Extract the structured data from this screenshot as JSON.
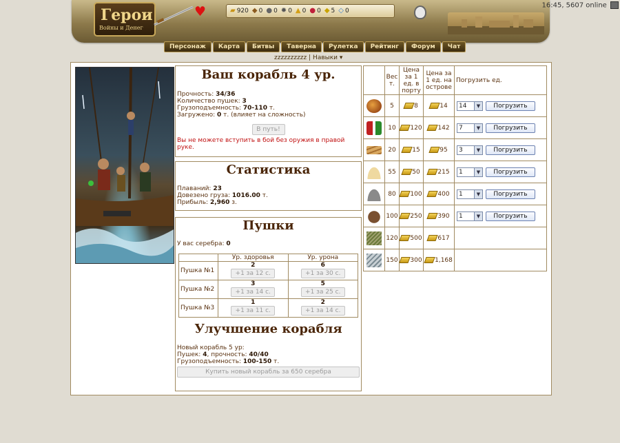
{
  "header": {
    "logo_title": "Герои",
    "logo_subtitle": "Войны и Денег",
    "resources": [
      {
        "icon": "gold-icon",
        "value": "920"
      },
      {
        "icon": "wood-icon",
        "value": "0"
      },
      {
        "icon": "ore-icon",
        "value": "0"
      },
      {
        "icon": "gear-resource-icon",
        "value": "0"
      },
      {
        "icon": "crystal-icon",
        "value": "0"
      },
      {
        "icon": "gem-icon",
        "value": "0"
      },
      {
        "icon": "sulfur-icon",
        "value": "5"
      },
      {
        "icon": "diamond-icon",
        "value": "0"
      }
    ],
    "clock": "16:45, 5607 online"
  },
  "nav": [
    "Персонаж",
    "Карта",
    "Битвы",
    "Таверна",
    "Рулетка",
    "Рейтинг",
    "Форум",
    "Чат"
  ],
  "subnav": {
    "user": "zzzzzzzzzz",
    "sep": "|",
    "skills": "Навыки ▾"
  },
  "ship": {
    "title": "Ваш корабль 4 ур.",
    "durability_label": "Прочность: ",
    "durability": "34/36",
    "cannons_label": "Количество пушек: ",
    "cannons": "3",
    "capacity_label": "Грузоподъемность: ",
    "capacity": "70-110",
    "capacity_unit": " т.",
    "loaded_label": "Загружено: ",
    "loaded": "0",
    "loaded_note": " т. (влияет на сложность)",
    "go_button": "В путь!",
    "warning": "Вы не можете вступить в бой без оружия в правой руке."
  },
  "stats": {
    "title": "Статистика",
    "voyages_label": "Плаваний: ",
    "voyages": "23",
    "delivered_label": "Довезено груза: ",
    "delivered": "1016.00",
    "delivered_unit": " т.",
    "profit_label": "Прибыль: ",
    "profit": "2,960",
    "profit_unit": " з."
  },
  "cannons": {
    "title": "Пушки",
    "silver_label": "У вас серебра: ",
    "silver": "0",
    "col_health": "Ур. здоровья",
    "col_damage": "Ур. урона",
    "rows": [
      {
        "name": "Пушка №1",
        "health": "2",
        "health_btn": "+1 за 12 с.",
        "damage": "6",
        "damage_btn": "+1 за 30 с."
      },
      {
        "name": "Пушка №2",
        "health": "3",
        "health_btn": "+1 за 14 с.",
        "damage": "5",
        "damage_btn": "+1 за 25 с."
      },
      {
        "name": "Пушка №3",
        "health": "1",
        "health_btn": "+1 за 11 с.",
        "damage": "2",
        "damage_btn": "+1 за 14 с."
      }
    ]
  },
  "upgrade": {
    "title": "Улучшение корабля",
    "line1": "Новый корабль 5 ур:",
    "cannons_label": "Пушек: ",
    "cannons": "4",
    "durability_label": ", прочность: ",
    "durability": "40/40",
    "capacity_label": "Грузоподъемность: ",
    "capacity": "100-150",
    "capacity_unit": " т.",
    "buy_button": "Купить новый корабль за 650 серебра"
  },
  "cargo": {
    "headers": {
      "weight": "Вес т.",
      "port_price": "Цена за 1 ед. в порту",
      "island_price": "Цена за 1 ед. на острове",
      "load": "Погрузить ед."
    },
    "load_button": "Погрузить",
    "rows": [
      {
        "icon": "fruit-sack-icon",
        "weight": "5",
        "port": "8",
        "island": "14",
        "qty": "14"
      },
      {
        "icon": "potion-bottles-icon",
        "weight": "10",
        "port": "120",
        "island": "142",
        "qty": "7"
      },
      {
        "icon": "wood-planks-icon",
        "weight": "20",
        "port": "15",
        "island": "95",
        "qty": "3"
      },
      {
        "icon": "sand-pile-icon",
        "weight": "55",
        "port": "50",
        "island": "215",
        "qty": "1"
      },
      {
        "icon": "ore-pile-icon",
        "weight": "80",
        "port": "100",
        "island": "400",
        "qty": "1"
      },
      {
        "icon": "clay-pot-icon",
        "weight": "100",
        "port": "250",
        "island": "390",
        "qty": "1"
      },
      {
        "icon": "herb-bundle-icon",
        "weight": "120",
        "port": "500",
        "island": "617",
        "qty": null
      },
      {
        "icon": "metal-bars-icon",
        "weight": "150",
        "port": "300",
        "island": "1,168",
        "qty": null
      }
    ]
  }
}
